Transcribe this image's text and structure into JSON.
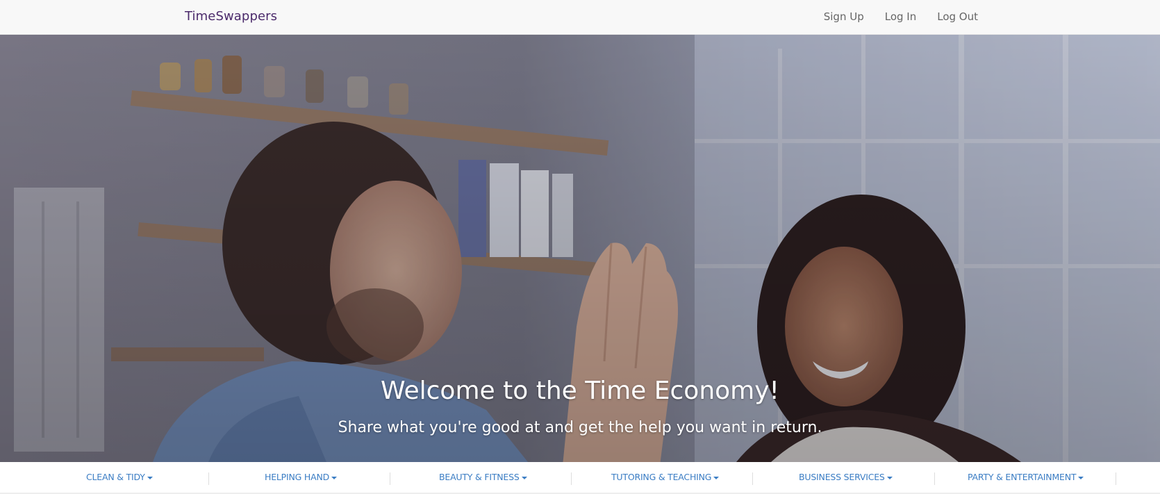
{
  "navbar": {
    "brand": "TimeSwappers",
    "links": [
      "Sign Up",
      "Log In",
      "Log Out"
    ]
  },
  "hero": {
    "title": "Welcome to the Time Economy!",
    "subtitle": "Share what you're good at and get the help you want in return."
  },
  "categories": [
    "CLEAN & TIDY",
    "HELPING HAND",
    "BEAUTY & FITNESS",
    "TUTORING & TEACHING",
    "BUSINESS SERVICES",
    "PARTY & ENTERTAINMENT"
  ],
  "colors": {
    "brand": "#4b2a6b",
    "category_link": "#3b7dc4",
    "nav_link": "#666666"
  }
}
